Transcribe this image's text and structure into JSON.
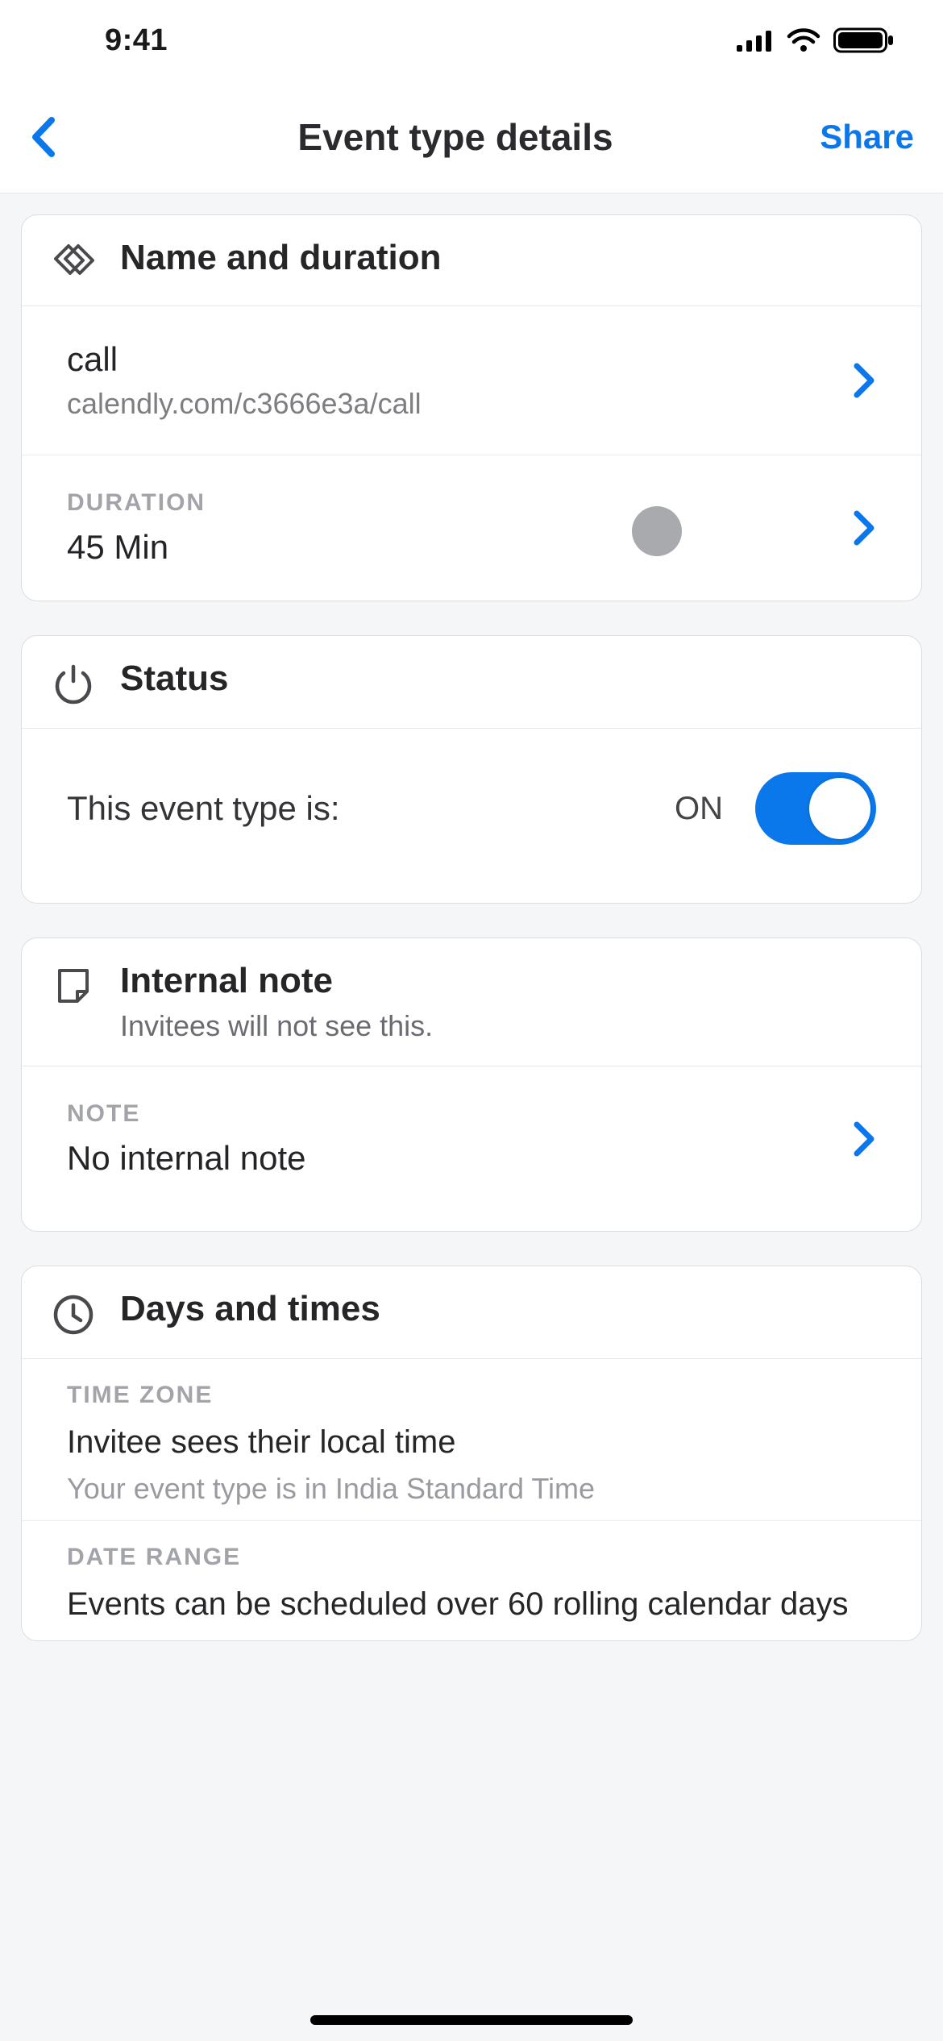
{
  "statusbar": {
    "time": "9:41"
  },
  "nav": {
    "title": "Event type details",
    "share": "Share"
  },
  "name_card": {
    "header": "Name and duration",
    "name": "call",
    "url": "calendly.com/c3666e3a/call",
    "duration_label": "DURATION",
    "duration_value": "45 Min"
  },
  "status_card": {
    "header": "Status",
    "label": "This event type is:",
    "state_text": "ON",
    "on": true
  },
  "note_card": {
    "header": "Internal note",
    "subtitle": "Invitees will not see this.",
    "note_label": "NOTE",
    "note_value": "No internal note"
  },
  "days_card": {
    "header": "Days and times",
    "tz_label": "TIME ZONE",
    "tz_line1": "Invitee sees their local time",
    "tz_line2": "Your event type is in India Standard Time",
    "dr_label": "DATE RANGE",
    "dr_value": "Events can be scheduled over 60 rolling calendar days"
  },
  "colors": {
    "accent": "#0a78ea"
  }
}
